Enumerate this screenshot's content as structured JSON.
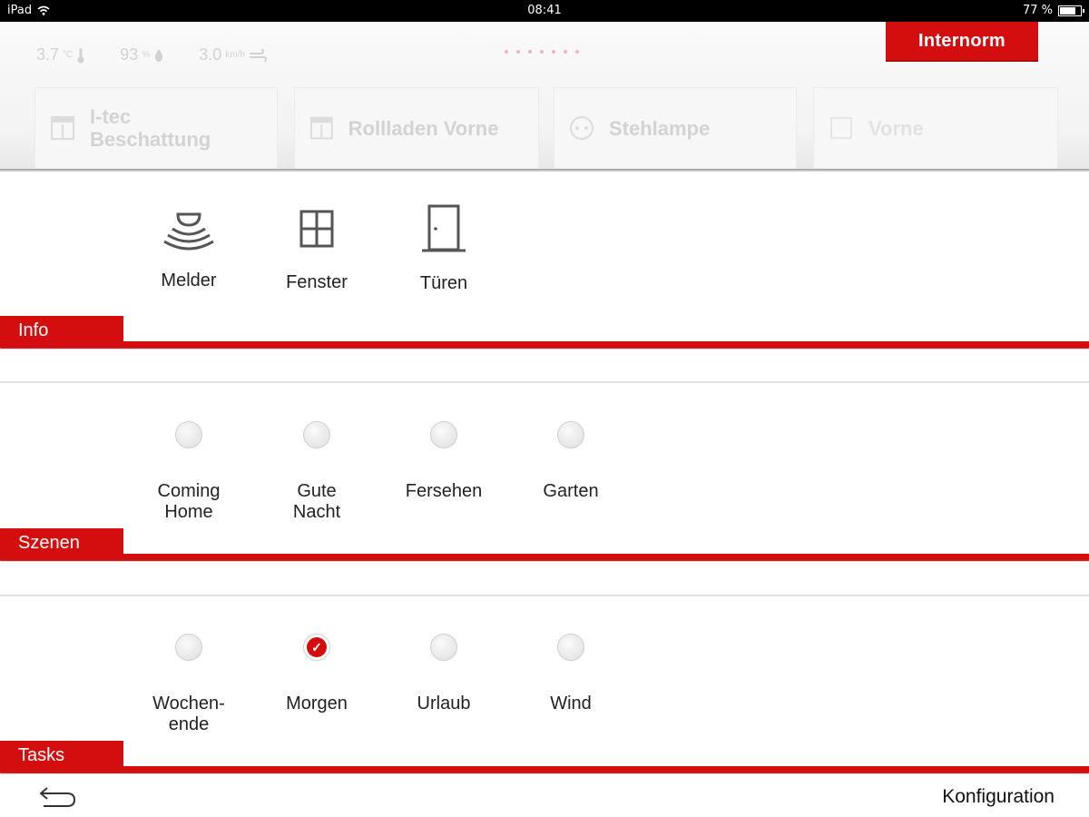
{
  "status": {
    "device": "iPad",
    "time": "08:41",
    "battery": "77 %",
    "battery_level": 0.77
  },
  "weather": [
    {
      "value": "3.7",
      "unit": "°C",
      "icon": "thermometer-icon"
    },
    {
      "value": "93",
      "unit": "%",
      "icon": "humidity-drop-icon"
    },
    {
      "value": "3.0",
      "unit": "km/h",
      "icon": "wind-icon"
    }
  ],
  "logo": "Internorm",
  "devices": [
    {
      "label": "I-tec Beschattung",
      "icon": "shade-icon"
    },
    {
      "label": "Rollladen Vorne",
      "icon": "shutter-icon"
    },
    {
      "label": "Stehlampe",
      "icon": "lamp-socket-icon"
    },
    {
      "label": "Vorne",
      "icon": "device-icon"
    }
  ],
  "info": {
    "title": "Info",
    "items": [
      {
        "label": "Melder",
        "icon": "detector-icon"
      },
      {
        "label": "Fenster",
        "icon": "window-icon"
      },
      {
        "label": "Türen",
        "icon": "door-icon"
      }
    ]
  },
  "szenen": {
    "title": "Szenen",
    "items": [
      {
        "line1": "Coming",
        "line2": "Home",
        "checked": false
      },
      {
        "line1": "Gute",
        "line2": "Nacht",
        "checked": false
      },
      {
        "line1": "Fersehen",
        "line2": "",
        "checked": false
      },
      {
        "line1": "Garten",
        "line2": "",
        "checked": false
      }
    ]
  },
  "tasks": {
    "title": "Tasks",
    "items": [
      {
        "line1": "Wochen-",
        "line2": "ende",
        "checked": false
      },
      {
        "line1": "Morgen",
        "line2": "",
        "checked": true
      },
      {
        "line1": "Urlaub",
        "line2": "",
        "checked": false
      },
      {
        "line1": "Wind",
        "line2": "",
        "checked": false
      }
    ]
  },
  "bottom": {
    "config_label": "Konfiguration",
    "back_icon": "back-arrow-icon"
  },
  "colors": {
    "accent": "#d40e0e"
  }
}
